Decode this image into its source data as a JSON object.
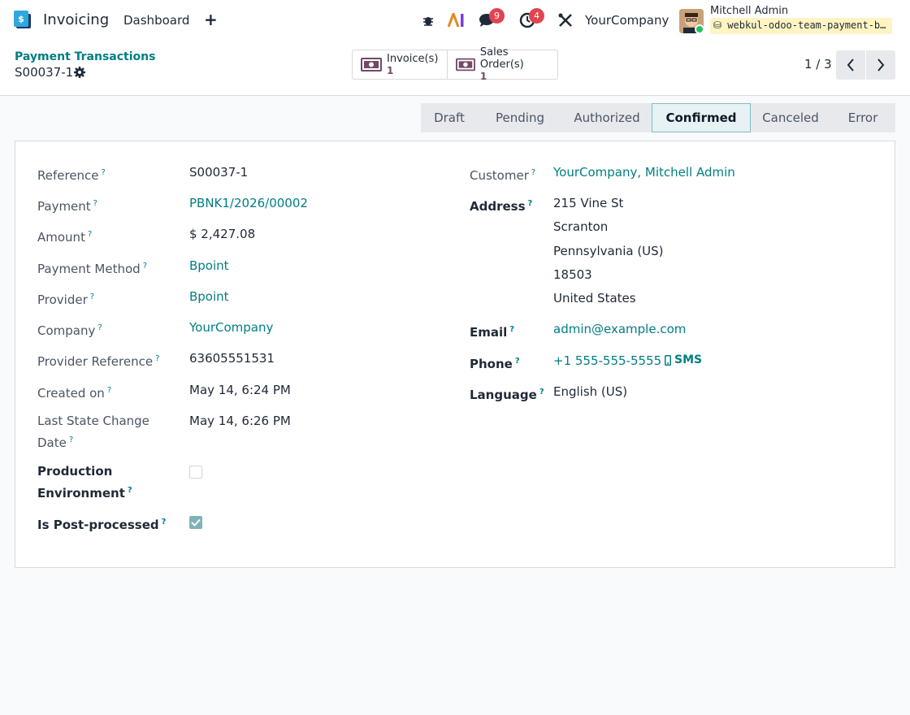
{
  "navbar": {
    "app_name": "Invoicing",
    "dashboard_label": "Dashboard",
    "new_label": "+",
    "messages_count": "9",
    "activities_count": "4",
    "company": "YourCompany",
    "user_name": "Mitchell Admin",
    "database": "webkul-odoo-team-payment-bpoint"
  },
  "control": {
    "breadcrumb_parent": "Payment Transactions",
    "record_name": "S00037-1",
    "smart_buttons": [
      {
        "label": "Invoice(s)",
        "count": "1"
      },
      {
        "label": "Sales Order(s)",
        "count": "1"
      }
    ],
    "pager": "1 / 3"
  },
  "status": {
    "stages": [
      "Draft",
      "Pending",
      "Authorized",
      "Confirmed",
      "Canceled",
      "Error"
    ],
    "active": "Confirmed"
  },
  "form": {
    "left": [
      {
        "label": "Reference",
        "value": "S00037-1"
      },
      {
        "label": "Payment",
        "value": "PBNK1/2026/00002"
      },
      {
        "label": "Amount",
        "value": "$ 2,427.08"
      },
      {
        "label": "Payment Method",
        "value": "Bpoint"
      },
      {
        "label": "Provider",
        "value": "Bpoint"
      },
      {
        "label": "Company",
        "value": "YourCompany"
      },
      {
        "label": "Provider Reference",
        "value": "63605551531"
      },
      {
        "label": "Created on",
        "value": "May 14, 6:24 PM"
      },
      {
        "label": "Last State Change Date",
        "value": "May 14, 6:26 PM"
      },
      {
        "label": "Production Environment",
        "value": false
      },
      {
        "label": "Is Post-processed",
        "value": true
      }
    ],
    "right": {
      "customer_label": "Customer",
      "customer_value": "YourCompany, Mitchell Admin",
      "address_label": "Address",
      "address_lines": [
        "215 Vine St",
        "Scranton",
        "Pennsylvania (US)",
        "18503",
        "United States"
      ],
      "email_label": "Email",
      "email_value": "admin@example.com",
      "phone_label": "Phone",
      "phone_value": "+1 555-555-5555",
      "sms_label": "SMS",
      "language_label": "Language",
      "language_value": "English (US)"
    },
    "help_mark": "?"
  }
}
